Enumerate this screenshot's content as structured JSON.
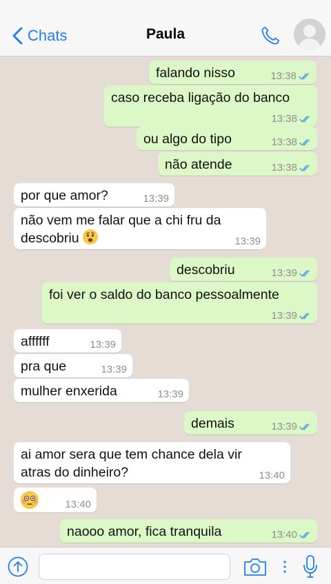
{
  "header": {
    "back_label": "Chats",
    "contact_name": "Paula"
  },
  "messages": [
    {
      "dir": "out",
      "text": "falando nisso",
      "time": "13:38"
    },
    {
      "dir": "out",
      "text": "caso receba ligação do banco",
      "time": "13:38"
    },
    {
      "dir": "out",
      "text": "ou algo do tipo",
      "time": "13:38"
    },
    {
      "dir": "out",
      "text": "não atende",
      "time": "13:38"
    },
    {
      "dir": "in",
      "text": "por que amor?",
      "time": "13:39"
    },
    {
      "dir": "in",
      "text_line1": "não vem me falar que a chi fru da",
      "text_line2": "descobriu",
      "emoji": "worried-face",
      "time": "13:39"
    },
    {
      "dir": "out",
      "text": "descobriu",
      "time": "13:39"
    },
    {
      "dir": "out",
      "text": "foi ver o saldo do banco pessoalmente",
      "time": "13:39"
    },
    {
      "dir": "in",
      "text": "affffff",
      "time": "13:39"
    },
    {
      "dir": "in",
      "text": "pra que",
      "time": "13:39"
    },
    {
      "dir": "in",
      "text": "mulher enxerida",
      "time": "13:39"
    },
    {
      "dir": "out",
      "text": "demais",
      "time": "13:39"
    },
    {
      "dir": "in",
      "text_line1": "ai amor sera que tem chance dela vir",
      "text_line2": "atras do dinheiro?",
      "time": "13:40"
    },
    {
      "dir": "in",
      "emoji": "flushed-face",
      "time": "13:40"
    },
    {
      "dir": "out",
      "text": "naooo amor, fica tranquila",
      "time": "13:40"
    }
  ],
  "input": {
    "placeholder": ""
  },
  "colors": {
    "accent": "#1e7ef2",
    "outgoing_bubble": "#dcf8c6",
    "incoming_bubble": "#ffffff",
    "chat_background": "#e5ddd5",
    "read_ticks": "#4fa3e0"
  }
}
